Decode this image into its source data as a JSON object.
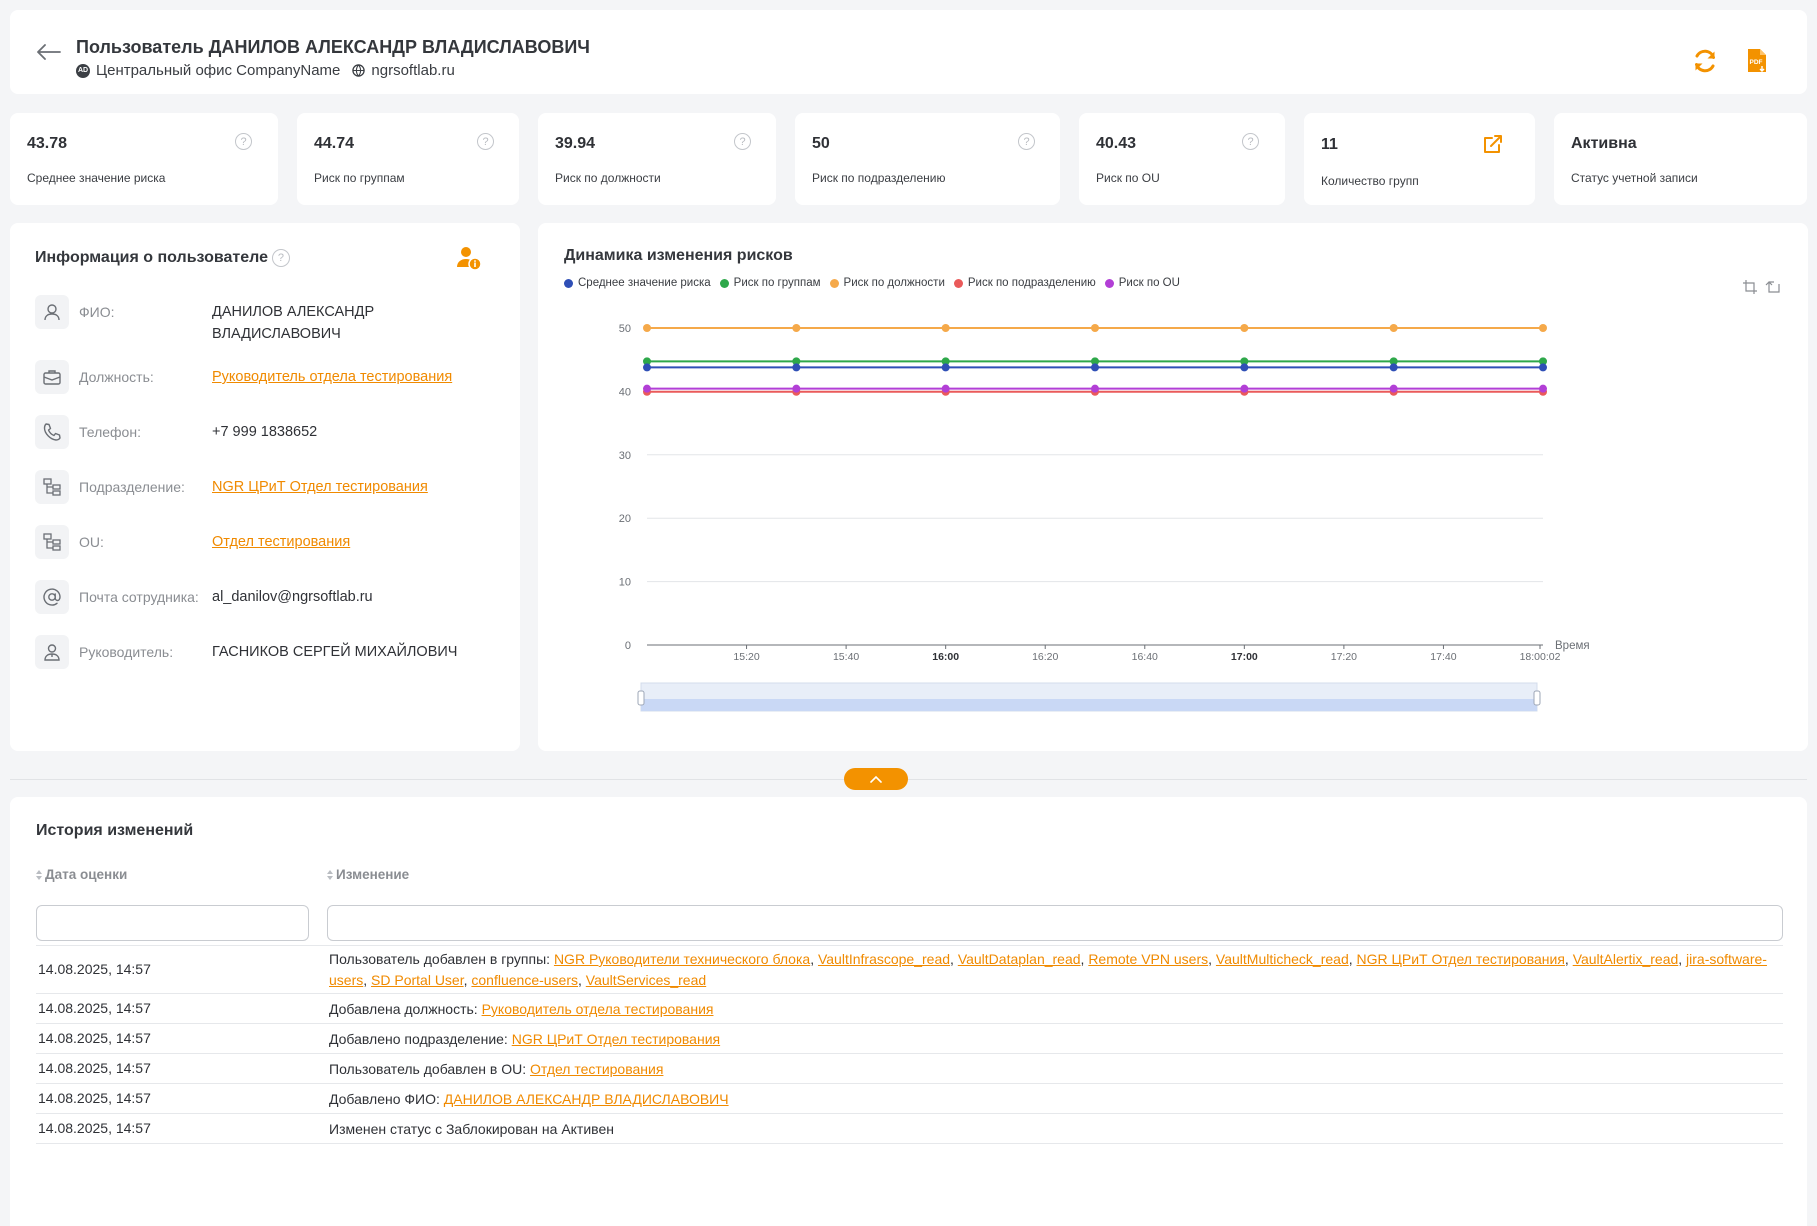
{
  "header": {
    "title": "Пользователь ДАНИЛОВ АЛЕКСАНДР ВЛАДИСЛАВОВИЧ",
    "ad_badge": "AD",
    "office": "Центральный офис CompanyName",
    "domain": "ngrsoftlab.ru",
    "pdf_badge": "PDF",
    "accent": "#f39200"
  },
  "stats": [
    {
      "value": "43.78",
      "label": "Среднее значение риска"
    },
    {
      "value": "44.74",
      "label": "Риск по группам"
    },
    {
      "value": "39.94",
      "label": "Риск по должности"
    },
    {
      "value": "50",
      "label": "Риск по подразделению"
    },
    {
      "value": "40.43",
      "label": "Риск по OU"
    },
    {
      "value": "11",
      "label": "Количество групп"
    },
    {
      "value": "Активна",
      "label": "Статус учетной записи"
    }
  ],
  "help_glyph": "?",
  "user_info": {
    "title": "Информация о пользователе",
    "rows": [
      {
        "key": "ФИО:",
        "value": "ДАНИЛОВ АЛЕКСАНДР ВЛАДИСЛАВОВИЧ",
        "icon": "person-icon"
      },
      {
        "key": "Должность:",
        "value": "Руководитель отдела тестирования",
        "icon": "briefcase-icon"
      },
      {
        "key": "Телефон:",
        "value": "+7 999 1838652",
        "icon": "phone-icon"
      },
      {
        "key": "Подразделение:",
        "value": "NGR ЦРиТ Отдел тестирования",
        "icon": "org-structure-icon"
      },
      {
        "key": "OU:",
        "value": "Отдел тестирования",
        "icon": "org-structure-icon"
      },
      {
        "key": "Почта сотрудника:",
        "value": "al_danilov@ngrsoftlab.ru",
        "icon": "at-icon"
      },
      {
        "key": "Руководитель:",
        "value": "ГАСНИКОВ СЕРГЕЙ МИХАЙЛОВИЧ",
        "icon": "manager-icon"
      }
    ]
  },
  "chart_data": {
    "type": "line",
    "title": "Динамика изменения рисков",
    "xlabel": "Время",
    "ylabel": "",
    "ylim": [
      0,
      50
    ],
    "yticks": [
      "0",
      "10",
      "20",
      "30",
      "40",
      "50"
    ],
    "xticks": [
      "15:20",
      "15:40",
      "16:00",
      "16:20",
      "16:40",
      "17:00",
      "17:20",
      "17:40",
      "18:00:02"
    ],
    "xticks_bold": [
      "16:00",
      "17:00"
    ],
    "legend": "top-left",
    "grid": true,
    "series": [
      {
        "name": "Среднее значение риска",
        "color": "#2f4fb6",
        "values": [
          43.78,
          43.78,
          43.78,
          43.78,
          43.78,
          43.78,
          43.78
        ]
      },
      {
        "name": "Риск по группам",
        "color": "#2ea84a",
        "values": [
          44.74,
          44.74,
          44.74,
          44.74,
          44.74,
          44.74,
          44.74
        ]
      },
      {
        "name": "Риск по должности",
        "color": "#f5a94a",
        "values": [
          50,
          50,
          50,
          50,
          50,
          50,
          50
        ]
      },
      {
        "name": "Риск по подразделению",
        "color": "#ea5a5a",
        "values": [
          39.94,
          39.94,
          39.94,
          39.94,
          39.94,
          39.94,
          39.94
        ]
      },
      {
        "name": "Риск по OU",
        "color": "#b23fd6",
        "values": [
          40.43,
          40.43,
          40.43,
          40.43,
          40.43,
          40.43,
          40.43
        ]
      }
    ]
  },
  "history": {
    "title": "История изменений",
    "col_date": "Дата оценки",
    "col_change": "Изменение",
    "filter_date": "",
    "filter_change": "",
    "rows": [
      {
        "date": "14.08.2025, 14:57",
        "text": "Пользователь добавлен в группы:",
        "links": [
          "NGR Руководители технического блока",
          "VaultInfrascope_read",
          "VaultDataplan_read",
          "Remote VPN users",
          "VaultMulticheck_read",
          "NGR ЦРиТ Отдел тестирования",
          "VaultAlertix_read",
          "jira-software-users",
          "SD Portal User",
          "confluence-users",
          "VaultServices_read"
        ]
      },
      {
        "date": "14.08.2025, 14:57",
        "text": "Добавлена должность:",
        "links": [
          "Руководитель отдела тестирования"
        ]
      },
      {
        "date": "14.08.2025, 14:57",
        "text": "Добавлено подразделение:",
        "links": [
          "NGR ЦРиТ Отдел тестирования"
        ]
      },
      {
        "date": "14.08.2025, 14:57",
        "text": "Пользователь добавлен в OU:",
        "links": [
          "Отдел тестирования"
        ]
      },
      {
        "date": "14.08.2025, 14:57",
        "text": "Добавлено ФИО:",
        "links": [
          "ДАНИЛОВ АЛЕКСАНДР ВЛАДИСЛАВОВИЧ"
        ]
      },
      {
        "date": "14.08.2025, 14:57",
        "text": "Изменен статус с Заблокирован на Активен",
        "links": []
      }
    ]
  }
}
